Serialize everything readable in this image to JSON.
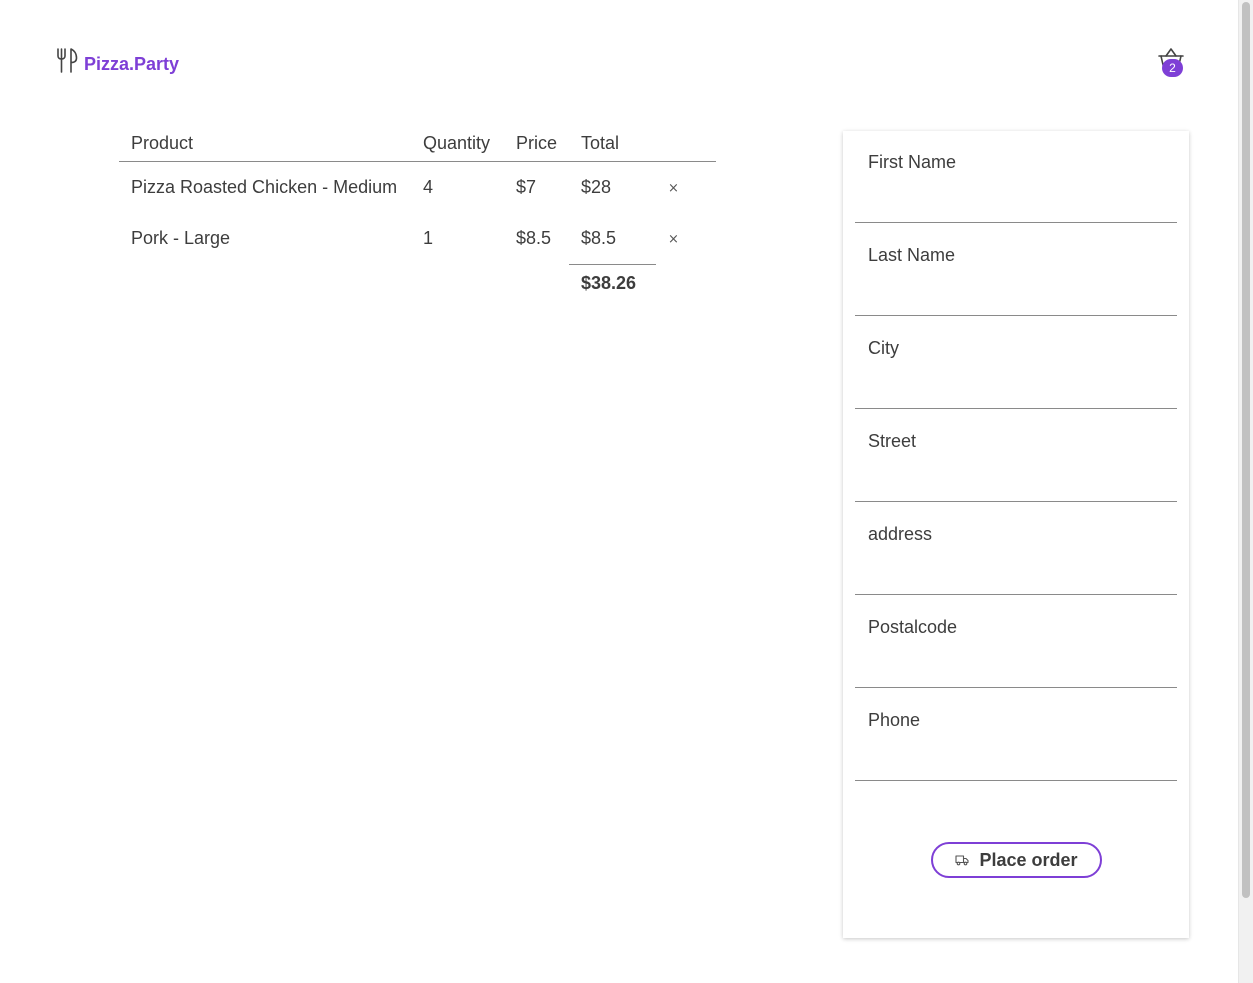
{
  "brand": {
    "name": "Pizza.Party",
    "icon": "utensils-icon",
    "color": "#7e3fd6"
  },
  "cart": {
    "icon": "basket-icon",
    "count": "2"
  },
  "table": {
    "headers": {
      "product": "Product",
      "quantity": "Quantity",
      "price": "Price",
      "total": "Total"
    },
    "rows": [
      {
        "product": "Pizza Roasted Chicken - Medium",
        "quantity": "4",
        "price": "$7",
        "total": "$28",
        "remove": "×"
      },
      {
        "product": "Pork - Large",
        "quantity": "1",
        "price": "$8.5",
        "total": "$8.5",
        "remove": "×"
      }
    ],
    "grand_total": "$38.26"
  },
  "form": {
    "fields": [
      {
        "label": "First Name",
        "value": ""
      },
      {
        "label": "Last Name",
        "value": ""
      },
      {
        "label": "City",
        "value": ""
      },
      {
        "label": "Street",
        "value": ""
      },
      {
        "label": "address",
        "value": ""
      },
      {
        "label": "Postalcode",
        "value": ""
      },
      {
        "label": "Phone",
        "value": ""
      }
    ],
    "submit": {
      "label": "Place order",
      "icon": "truck-icon"
    }
  }
}
